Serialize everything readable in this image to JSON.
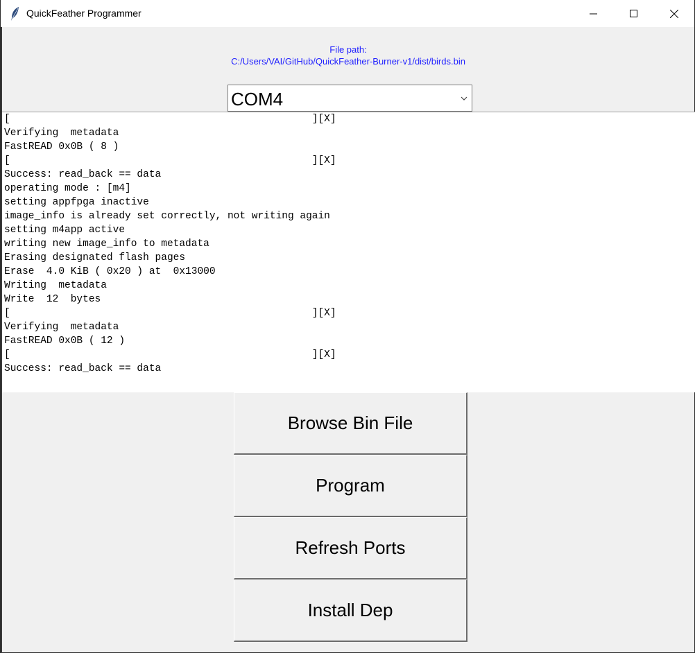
{
  "window": {
    "title": "QuickFeather Programmer",
    "icon": "feather-icon"
  },
  "file_path": {
    "label": "File path:",
    "value": "C:/Users/VAI/GitHub/QuickFeather-Burner-v1/dist/birds.bin"
  },
  "port_select": {
    "value": "COM4"
  },
  "log": [
    "[                                                  ][X]",
    "Verifying  metadata",
    "FastREAD 0x0B ( 8 )",
    "[                                                  ][X]",
    "Success: read_back == data",
    "operating mode : [m4]",
    "setting appfpga inactive",
    "image_info is already set correctly, not writing again",
    "setting m4app active",
    "writing new image_info to metadata",
    "Erasing designated flash pages",
    "Erase  4.0 KiB ( 0x20 ) at  0x13000",
    "Writing  metadata",
    "Write  12  bytes",
    "[                                                  ][X]",
    "Verifying  metadata",
    "FastREAD 0x0B ( 12 )",
    "[                                                  ][X]",
    "Success: read_back == data"
  ],
  "buttons": {
    "browse": "Browse Bin File",
    "program": "Program",
    "refresh": "Refresh Ports",
    "install": "Install Dep"
  },
  "colors": {
    "file_path_text": "#1f1fff",
    "window_bg": "#f0f0f0"
  }
}
